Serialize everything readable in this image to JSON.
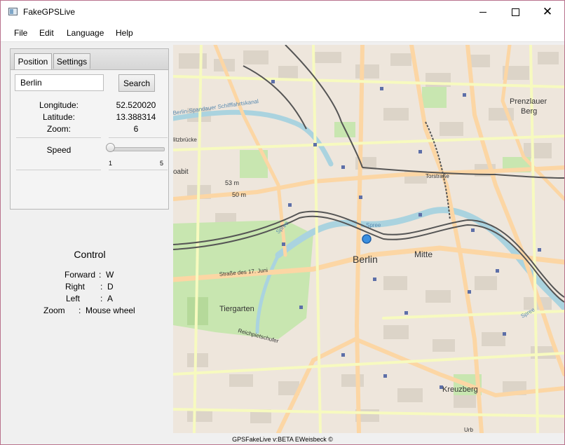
{
  "window": {
    "title": "FakeGPSLive",
    "close_glyph": "✕"
  },
  "menu": [
    "File",
    "Edit",
    "Language",
    "Help"
  ],
  "tabs": {
    "position": "Position",
    "settings": "Settings"
  },
  "search": {
    "value": "Berlin",
    "button": "Search"
  },
  "info": {
    "longitude_label": "Longitude:",
    "longitude": "52.520020",
    "latitude_label": "Latitude:",
    "latitude": "13.388314",
    "zoom_label": "Zoom:",
    "zoom": "6"
  },
  "speed": {
    "label": "Speed",
    "min": "1",
    "max": "5",
    "value": 1
  },
  "control": {
    "title": "Control",
    "rows": [
      {
        "action": "Forward",
        "sep": ":",
        "key": "W"
      },
      {
        "action": "Right",
        "sep": ":",
        "key": "D"
      },
      {
        "action": "Left",
        "sep": ":",
        "key": "A"
      },
      {
        "action": "Zoom",
        "sep": ":",
        "key": "Mouse wheel"
      }
    ]
  },
  "map": {
    "labels": {
      "berlin": "Berlin",
      "mitte": "Mitte",
      "prenzlauer": "Prenzlauer",
      "berg": "Berg",
      "tiergarten": "Tiergarten",
      "kreuzberg": "Kreuzberg",
      "moabit": "oabit",
      "strasse17": "Straße des 17. Juni",
      "torstrasse": "Torstraße",
      "spree1": "Spree",
      "spree2": "Spree",
      "spree3": "Spree",
      "spree4": "Spree",
      "berlin_spandauer": "Berlin-Spandauer Schifffahrtskanal",
      "m53": "53 m",
      "m50": "50 m",
      "reichpietsch": "Reichpietschufer",
      "litzbrucke": "litzbrücke",
      "urb": "Urb"
    },
    "colors": {
      "marker": "#3b8fe0",
      "water": "#aad3df",
      "park": "#c8e6b0",
      "primary": "#fcd6a4",
      "secondary": "#f7fabf",
      "rail": "#555555"
    }
  },
  "status": "GPSFakeLive v:BETA  EWeisbeck ©"
}
